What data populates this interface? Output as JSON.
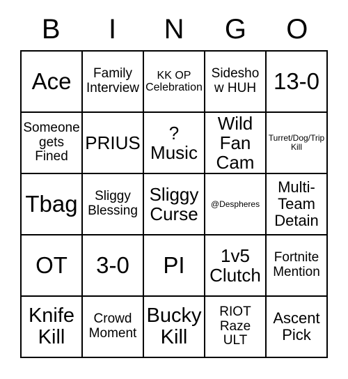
{
  "card": {
    "title_letters": [
      "B",
      "I",
      "N",
      "G",
      "O"
    ],
    "columns": 5,
    "rows": 5,
    "border_color": "#000000",
    "background_color": "#ffffff",
    "text_color": "#000000",
    "cells": [
      [
        {
          "text": "Ace",
          "size": "fs-xxl"
        },
        {
          "text": "Family Interview",
          "size": "fs-sm"
        },
        {
          "text": "KK OP Celebration",
          "size": "fs-xs"
        },
        {
          "text": "Sideshow HUH",
          "size": "fs-sm"
        },
        {
          "text": "13-0",
          "size": "fs-xxl"
        }
      ],
      [
        {
          "text": "Someone gets Fined",
          "size": "fs-sm"
        },
        {
          "text": "PRIUS",
          "size": "fs-lg"
        },
        {
          "text": "? Music",
          "size": "fs-lg"
        },
        {
          "text": "Wild Fan Cam",
          "size": "fs-lg"
        },
        {
          "text": "Turret/Dog/Trip Kill",
          "size": "fs-xxs"
        }
      ],
      [
        {
          "text": "Tbag",
          "size": "fs-xxl"
        },
        {
          "text": "Sliggy Blessing",
          "size": "fs-sm"
        },
        {
          "text": "Sliggy Curse",
          "size": "fs-lg"
        },
        {
          "text": "@Despheres",
          "size": "fs-xxs"
        },
        {
          "text": "Multi-Team Detain",
          "size": "fs-md"
        }
      ],
      [
        {
          "text": "OT",
          "size": "fs-xxl"
        },
        {
          "text": "3-0",
          "size": "fs-xxl"
        },
        {
          "text": "PI",
          "size": "fs-xxl"
        },
        {
          "text": "1v5 Clutch",
          "size": "fs-lg"
        },
        {
          "text": "Fortnite Mention",
          "size": "fs-sm"
        }
      ],
      [
        {
          "text": "Knife Kill",
          "size": "fs-xl"
        },
        {
          "text": "Crowd Moment",
          "size": "fs-sm"
        },
        {
          "text": "Bucky Kill",
          "size": "fs-xl"
        },
        {
          "text": "RIOT Raze ULT",
          "size": "fs-sm"
        },
        {
          "text": "Ascent Pick",
          "size": "fs-md"
        }
      ]
    ]
  }
}
